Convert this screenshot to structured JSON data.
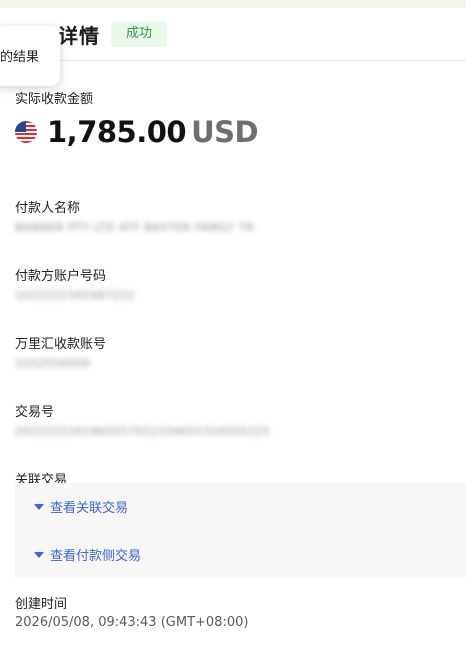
{
  "header": {
    "title": "详情",
    "status": "成功"
  },
  "tooltip": {
    "text": "的结果"
  },
  "amount": {
    "label": "实际收款金额",
    "value": "1,785.00",
    "currency": "USD",
    "flag": "us-flag-icon"
  },
  "payer_name": {
    "label": "付款人名称",
    "value": "BANNER PTY LTD ATF BAXTER FAMILY TR"
  },
  "payer_account": {
    "label": "付款方账户号码",
    "value": "1022222345987222"
  },
  "wanlihui_account": {
    "label": "万里汇收款账号",
    "value": "3202556009"
  },
  "transaction_id": {
    "label": "交易号",
    "value": "2022222261965557022334655324555225"
  },
  "related": {
    "label": "关联交易",
    "links": [
      "查看关联交易",
      "查看付款侧交易"
    ],
    "link_color": "#3f66c8"
  },
  "created": {
    "label": "创建时间",
    "value": "2026/05/08, 09:43:43 (GMT+08:00)"
  },
  "colors": {
    "success_bg": "#eaf8ec",
    "success_text": "#2e9b48"
  }
}
